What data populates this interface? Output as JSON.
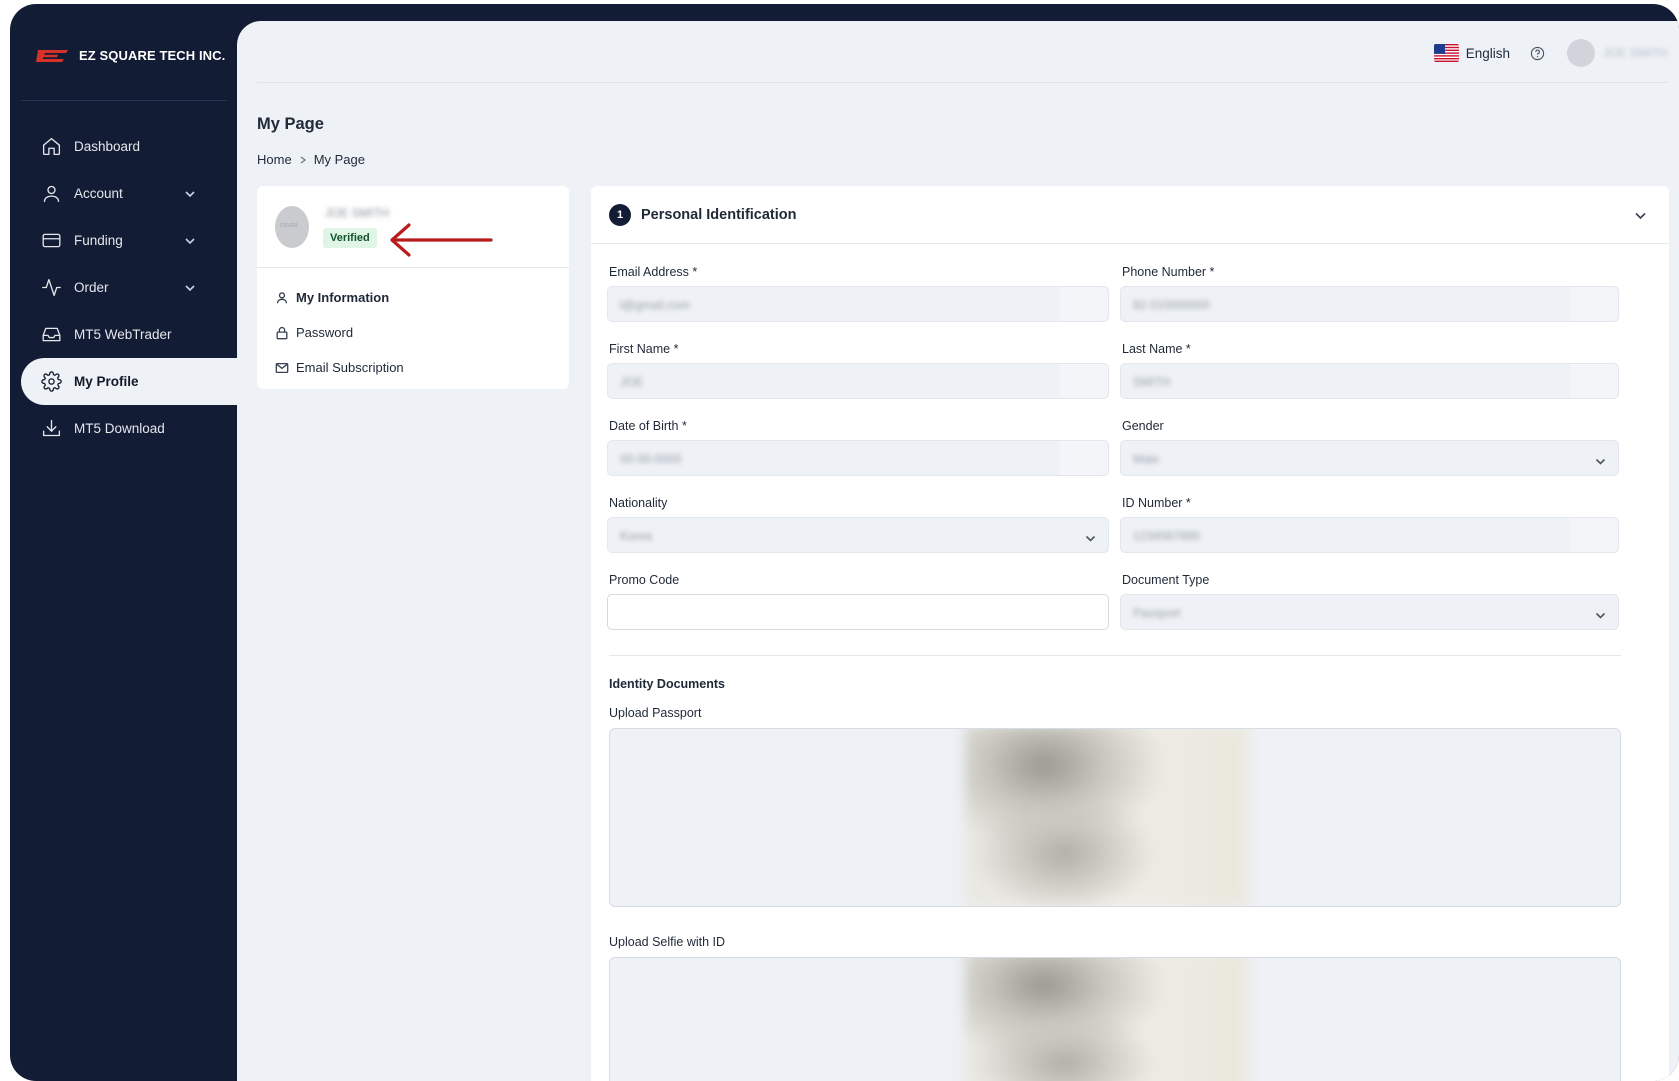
{
  "brand": {
    "name": "EZ SQUARE TECH INC.",
    "logo_text": "EZ"
  },
  "sidebar": {
    "items": [
      {
        "label": "Dashboard",
        "icon": "home-icon",
        "expandable": false
      },
      {
        "label": "Account",
        "icon": "user-icon",
        "expandable": true
      },
      {
        "label": "Funding",
        "icon": "card-icon",
        "expandable": true
      },
      {
        "label": "Order",
        "icon": "activity-icon",
        "expandable": true
      },
      {
        "label": "MT5 WebTrader",
        "icon": "inbox-icon",
        "expandable": false
      },
      {
        "label": "My Profile",
        "icon": "gear-icon",
        "expandable": false,
        "active": true
      },
      {
        "label": "MT5 Download",
        "icon": "download-icon",
        "expandable": false
      }
    ]
  },
  "topbar": {
    "language": "English",
    "username": "JOE SMITH"
  },
  "page": {
    "title": "My Page",
    "breadcrumb": [
      "Home",
      "My Page"
    ]
  },
  "profile": {
    "name": "JOE SMITH",
    "avatar_text": "COVER",
    "status": "Verified",
    "menu": [
      {
        "label": "My Information",
        "icon": "user-icon",
        "active": true
      },
      {
        "label": "Password",
        "icon": "lock-icon"
      },
      {
        "label": "Email Subscription",
        "icon": "mail-icon"
      }
    ]
  },
  "form": {
    "step": "1",
    "section_title": "Personal Identification",
    "fields": {
      "email": {
        "label": "Email Address *",
        "value": "l@gmail.com"
      },
      "phone": {
        "label": "Phone Number *",
        "value": "82 010000000"
      },
      "first_name": {
        "label": "First Name *",
        "value": "JOE"
      },
      "last_name": {
        "label": "Last Name *",
        "value": "SMITH"
      },
      "dob": {
        "label": "Date of Birth *",
        "value": "00-00-0000"
      },
      "gender": {
        "label": "Gender",
        "value": "Male"
      },
      "nationality": {
        "label": "Nationality",
        "value": "Korea"
      },
      "id_number": {
        "label": "ID Number *",
        "value": "1234567890"
      },
      "promo": {
        "label": "Promo Code",
        "value": ""
      },
      "doc_type": {
        "label": "Document Type",
        "value": "Passport"
      }
    },
    "identity_title": "Identity Documents",
    "upload_passport": "Upload Passport",
    "upload_selfie": "Upload Selfie with ID"
  },
  "colors": {
    "sidebar_bg": "#131c35",
    "content_bg": "#eef2f7",
    "verified_bg": "#dff5e6",
    "arrow": "#b91c1c",
    "logo_red": "#d6322a"
  }
}
